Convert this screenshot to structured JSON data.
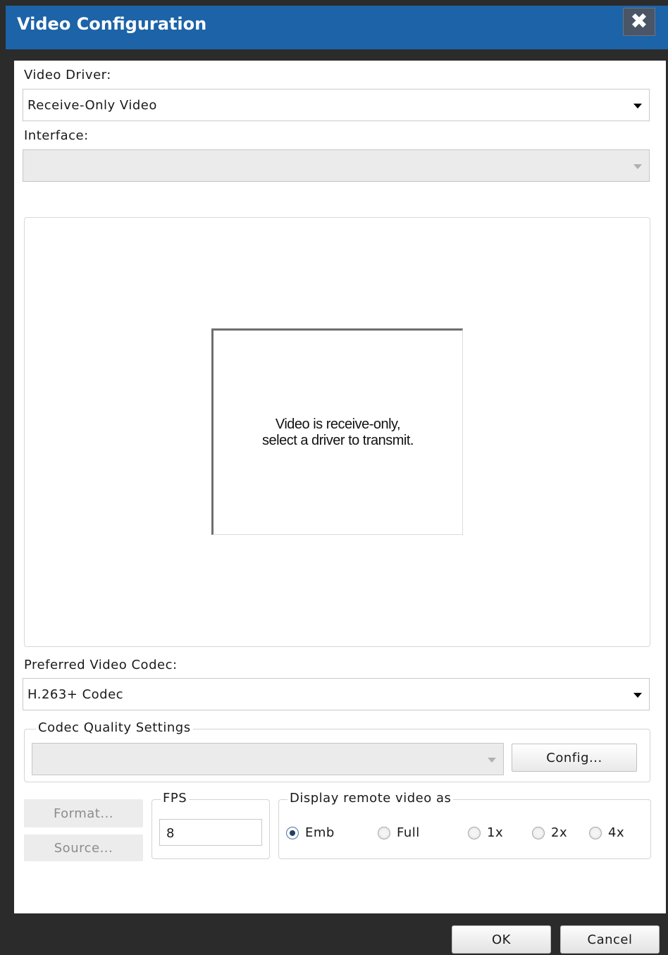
{
  "window": {
    "title": "Video Configuration",
    "close_glyph": "✖"
  },
  "video_driver": {
    "label": "Video Driver:",
    "selected": "Receive-Only Video"
  },
  "interface": {
    "label": "Interface:",
    "selected": ""
  },
  "preview": {
    "line1": "Video is receive-only,",
    "line2": "select a driver to transmit."
  },
  "codec": {
    "label": "Preferred Video Codec:",
    "selected": "H.263+ Codec"
  },
  "quality": {
    "legend": "Codec Quality Settings",
    "selected": "",
    "config_label": "Config..."
  },
  "side_buttons": {
    "format_label": "Format...",
    "source_label": "Source..."
  },
  "fps": {
    "legend": "FPS",
    "value": "8"
  },
  "remote_display": {
    "legend": "Display remote video as",
    "options": [
      {
        "label": "Emb",
        "selected": true
      },
      {
        "label": "Full",
        "selected": false
      },
      {
        "label": "1x",
        "selected": false
      },
      {
        "label": "2x",
        "selected": false
      },
      {
        "label": "4x",
        "selected": false
      }
    ]
  },
  "footer": {
    "ok_label": "OK",
    "cancel_label": "Cancel"
  },
  "colors": {
    "titlebar": "#1c63a8",
    "frame": "#2b2b2b",
    "radio_selected": "#1e3f66"
  }
}
